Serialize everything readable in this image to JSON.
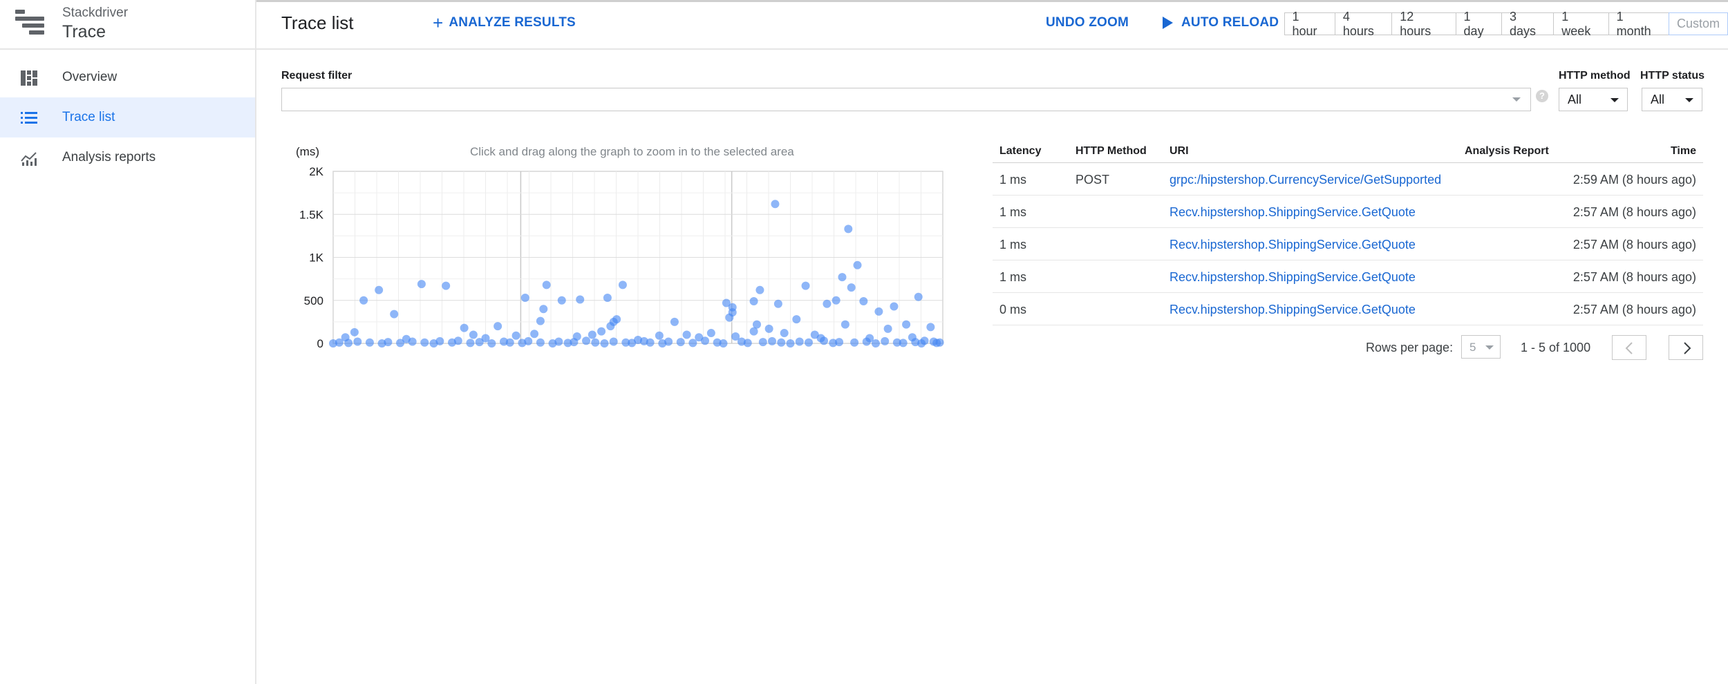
{
  "app": {
    "suite": "Stackdriver",
    "product": "Trace"
  },
  "sidebar": {
    "items": [
      {
        "label": "Overview",
        "icon": "dashboard-icon",
        "active": false
      },
      {
        "label": "Trace list",
        "icon": "list-icon",
        "active": true
      },
      {
        "label": "Analysis reports",
        "icon": "analytics-icon",
        "active": false
      }
    ]
  },
  "header": {
    "title": "Trace list",
    "analyze_label": "ANALYZE RESULTS",
    "undo_zoom_label": "UNDO ZOOM",
    "auto_reload_label": "AUTO RELOAD",
    "ranges": [
      "1 hour",
      "4 hours",
      "12 hours",
      "1 day",
      "3 days",
      "1 week",
      "1 month",
      "Custom"
    ],
    "selected_range": "Custom"
  },
  "filters": {
    "request_filter_label": "Request filter",
    "request_filter_value": "",
    "help_glyph": "?",
    "http_method_label": "HTTP method",
    "http_method_value": "All",
    "http_status_label": "HTTP status",
    "http_status_value": "All"
  },
  "chart_data": {
    "type": "scatter",
    "hint": "Click and drag along the graph to zoom in to the selected area",
    "ylabel": "(ms)",
    "yticks": [
      "2K",
      "1.5K",
      "1K",
      "500",
      "0"
    ],
    "ylim": [
      0,
      2000
    ],
    "xlim": [
      0,
      100
    ],
    "grid": true,
    "point_color": "#4285f4",
    "series": [
      {
        "points": [
          [
            5,
            500
          ],
          [
            7.5,
            620
          ],
          [
            10,
            340
          ],
          [
            14.5,
            690
          ],
          [
            18.5,
            670
          ],
          [
            31.5,
            530
          ],
          [
            34.5,
            400
          ],
          [
            34,
            260
          ],
          [
            35,
            680
          ],
          [
            37.5,
            500
          ],
          [
            40.5,
            510
          ],
          [
            45.5,
            200
          ],
          [
            46,
            250
          ],
          [
            46.5,
            280
          ],
          [
            45,
            530
          ],
          [
            47.5,
            680
          ],
          [
            44,
            140
          ],
          [
            56,
            250
          ],
          [
            64.5,
            470
          ],
          [
            65.5,
            420
          ],
          [
            65,
            300
          ],
          [
            65.5,
            360
          ],
          [
            69,
            490
          ],
          [
            69.5,
            220
          ],
          [
            70,
            620
          ],
          [
            72.5,
            1620
          ],
          [
            73,
            460
          ],
          [
            77.5,
            670
          ],
          [
            81,
            460
          ],
          [
            82.5,
            500
          ],
          [
            83.5,
            770
          ],
          [
            84,
            220
          ],
          [
            84.5,
            1330
          ],
          [
            85,
            650
          ],
          [
            86,
            910
          ],
          [
            87,
            490
          ],
          [
            89.5,
            370
          ],
          [
            91,
            170
          ],
          [
            92,
            430
          ],
          [
            94,
            220
          ],
          [
            96,
            540
          ],
          [
            98,
            190
          ],
          [
            3.5,
            130
          ],
          [
            21.5,
            180
          ],
          [
            23,
            100
          ],
          [
            27,
            200
          ],
          [
            33,
            110
          ],
          [
            42.5,
            100
          ],
          [
            53.5,
            90
          ],
          [
            60,
            70
          ],
          [
            62,
            120
          ],
          [
            69,
            140
          ],
          [
            71.5,
            170
          ],
          [
            79,
            100
          ],
          [
            88,
            60
          ],
          [
            76,
            280
          ],
          [
            58,
            100
          ],
          [
            40,
            80
          ],
          [
            25,
            60
          ],
          [
            12,
            50
          ],
          [
            2,
            70
          ],
          [
            30,
            90
          ],
          [
            50,
            40
          ],
          [
            66,
            80
          ],
          [
            74,
            120
          ],
          [
            80,
            60
          ],
          [
            95,
            70
          ],
          [
            97,
            30
          ],
          [
            99.5,
            10
          ],
          [
            0,
            0
          ],
          [
            1,
            10
          ],
          [
            2.5,
            5
          ],
          [
            4,
            20
          ],
          [
            6,
            10
          ],
          [
            8,
            0
          ],
          [
            9,
            15
          ],
          [
            11,
            5
          ],
          [
            13,
            20
          ],
          [
            15,
            10
          ],
          [
            16.5,
            0
          ],
          [
            17.5,
            25
          ],
          [
            19.5,
            10
          ],
          [
            20.5,
            30
          ],
          [
            22.5,
            5
          ],
          [
            24,
            15
          ],
          [
            26,
            0
          ],
          [
            28,
            20
          ],
          [
            29,
            10
          ],
          [
            31,
            5
          ],
          [
            32,
            25
          ],
          [
            34,
            10
          ],
          [
            36,
            0
          ],
          [
            37,
            20
          ],
          [
            38.5,
            5
          ],
          [
            39.5,
            15
          ],
          [
            41.5,
            30
          ],
          [
            43,
            10
          ],
          [
            44.5,
            0
          ],
          [
            46,
            20
          ],
          [
            48,
            10
          ],
          [
            49,
            5
          ],
          [
            51,
            25
          ],
          [
            52,
            10
          ],
          [
            54,
            0
          ],
          [
            55,
            20
          ],
          [
            57,
            15
          ],
          [
            59,
            5
          ],
          [
            61,
            30
          ],
          [
            63,
            10
          ],
          [
            64,
            0
          ],
          [
            67,
            20
          ],
          [
            68,
            5
          ],
          [
            70.5,
            15
          ],
          [
            72,
            25
          ],
          [
            73.5,
            10
          ],
          [
            75,
            0
          ],
          [
            76.5,
            20
          ],
          [
            78,
            10
          ],
          [
            80.5,
            30
          ],
          [
            82,
            5
          ],
          [
            83,
            15
          ],
          [
            85.5,
            10
          ],
          [
            87.5,
            20
          ],
          [
            89,
            0
          ],
          [
            90.5,
            25
          ],
          [
            92.5,
            10
          ],
          [
            93.5,
            5
          ],
          [
            95.5,
            15
          ],
          [
            96.5,
            0
          ],
          [
            98.5,
            20
          ],
          [
            99,
            5
          ]
        ]
      }
    ]
  },
  "table": {
    "columns": [
      "Latency",
      "HTTP Method",
      "URI",
      "Analysis Report",
      "Time"
    ],
    "rows": [
      {
        "latency": "1 ms",
        "method": "POST",
        "uri": "grpc:/hipstershop.CurrencyService/GetSupported",
        "report": "",
        "time": "2:59 AM  (8 hours ago)"
      },
      {
        "latency": "1 ms",
        "method": "",
        "uri": "Recv.hipstershop.ShippingService.GetQuote",
        "report": "",
        "time": "2:57 AM  (8 hours ago)"
      },
      {
        "latency": "1 ms",
        "method": "",
        "uri": "Recv.hipstershop.ShippingService.GetQuote",
        "report": "",
        "time": "2:57 AM  (8 hours ago)"
      },
      {
        "latency": "1 ms",
        "method": "",
        "uri": "Recv.hipstershop.ShippingService.GetQuote",
        "report": "",
        "time": "2:57 AM  (8 hours ago)"
      },
      {
        "latency": "0 ms",
        "method": "",
        "uri": "Recv.hipstershop.ShippingService.GetQuote",
        "report": "",
        "time": "2:57 AM  (8 hours ago)"
      }
    ]
  },
  "pagination": {
    "rows_per_page_label": "Rows per page:",
    "rows_per_page_value": "5",
    "range_text": "1 - 5 of 1000"
  }
}
